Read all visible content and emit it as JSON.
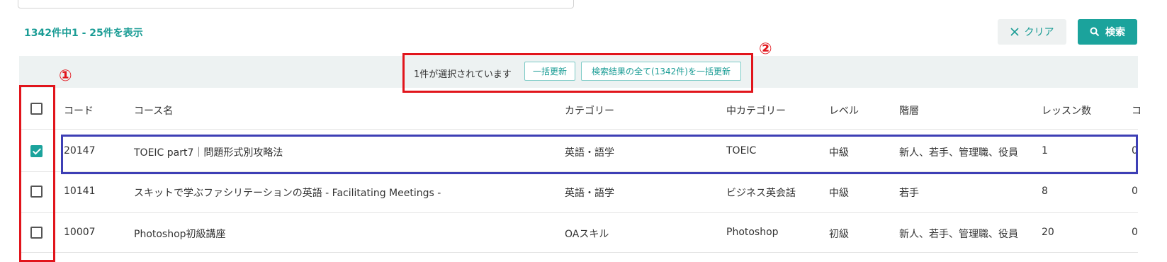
{
  "result_count": "1342件中1 - 25件を表示",
  "buttons": {
    "clear": "クリア",
    "search": "検索"
  },
  "bulk": {
    "selected_text": "1件が選択されています",
    "update_selected": "一括更新",
    "update_all": "検索結果の全て(1342件)を一括更新"
  },
  "table": {
    "headers": [
      "コード",
      "コース名",
      "カテゴリー",
      "中カテゴリー",
      "レベル",
      "階層",
      "レッスン数",
      "コ"
    ],
    "rows": [
      {
        "checked": true,
        "code": "20147",
        "name": "TOEIC part7｜問題形式別攻略法",
        "category": "英語・語学",
        "sub_category": "TOEIC",
        "level": "中級",
        "hierarchy": "新人、若手、管理職、役員",
        "lessons": "1",
        "extra": "0"
      },
      {
        "checked": false,
        "code": "10141",
        "name": "スキットで学ぶファシリテーションの英語 - Facilitating Meetings -",
        "category": "英語・語学",
        "sub_category": "ビジネス英会話",
        "level": "中級",
        "hierarchy": "若手",
        "lessons": "8",
        "extra": "0"
      },
      {
        "checked": false,
        "code": "10007",
        "name": "Photoshop初級講座",
        "category": "OAスキル",
        "sub_category": "Photoshop",
        "level": "初級",
        "hierarchy": "新人、若手、管理職、役員",
        "lessons": "20",
        "extra": "0"
      }
    ]
  },
  "annotations": {
    "label_1": "①",
    "label_2": "②"
  },
  "colors": {
    "accent": "#1ba39c",
    "annotation_red": "#e1151c",
    "annotation_blue": "#3d3fb5"
  }
}
